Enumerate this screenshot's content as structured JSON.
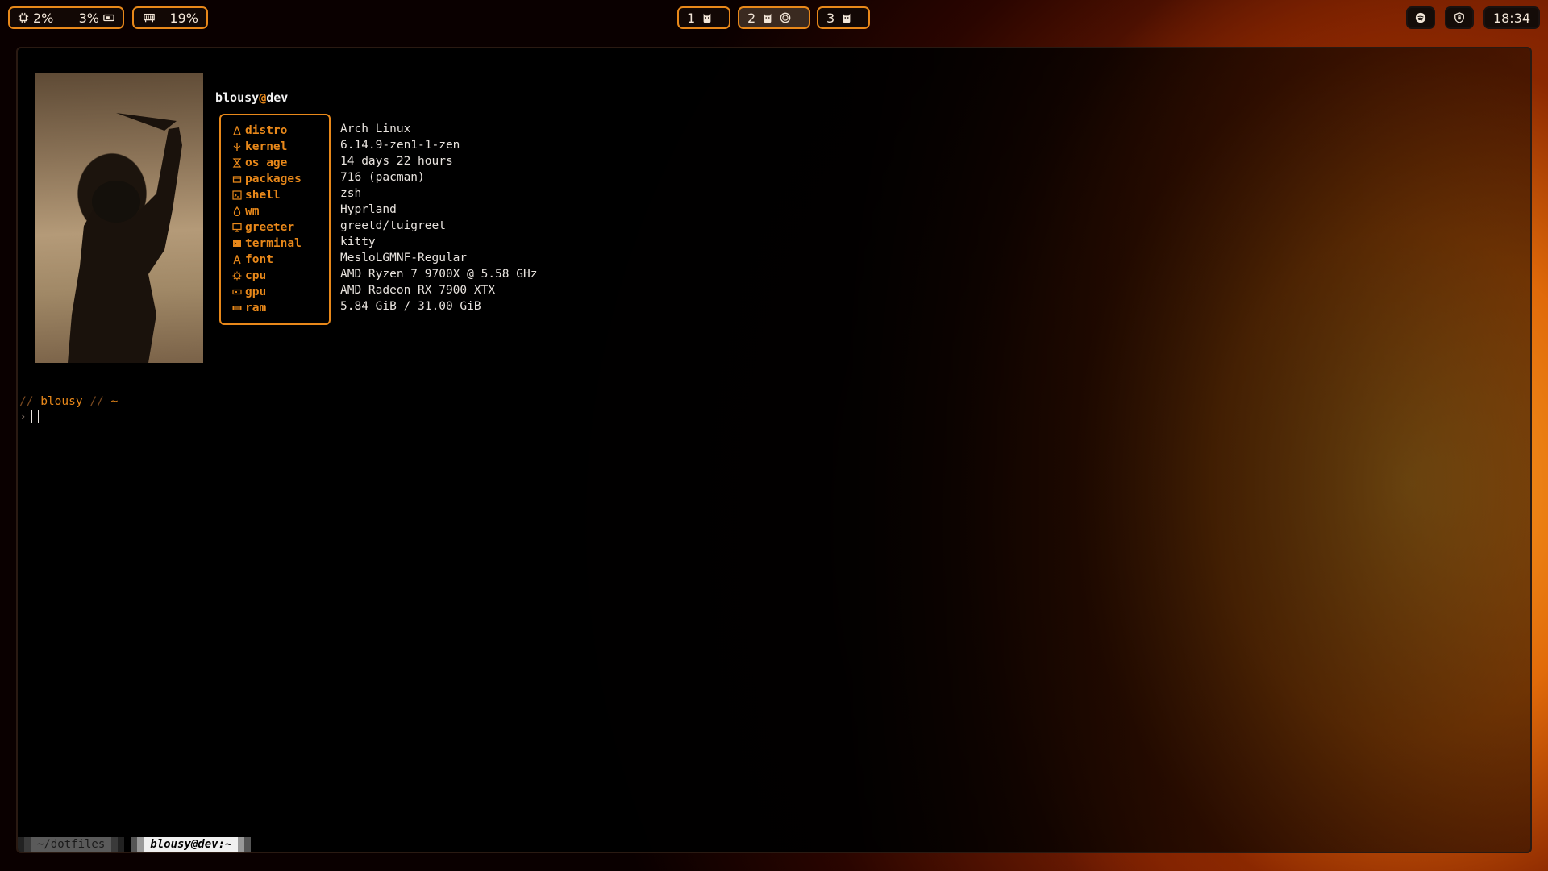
{
  "topbar": {
    "cpu_usage": "2%",
    "gpu_usage": "3%",
    "memory_usage": "19%",
    "workspaces": [
      {
        "number": "1",
        "icons": [
          "kitty-icon"
        ]
      },
      {
        "number": "2",
        "icons": [
          "kitty-icon",
          "spotify-icon"
        ],
        "active": true
      },
      {
        "number": "3",
        "icons": [
          "kitty-icon"
        ]
      }
    ],
    "clock": "18:34"
  },
  "fetch": {
    "user": "blousy",
    "at": "@",
    "host": "dev",
    "rows": [
      {
        "label": "distro",
        "icon": "linux-icon",
        "value": "Arch Linux"
      },
      {
        "label": "kernel",
        "icon": "kernel-icon",
        "value": "6.14.9-zen1-1-zen"
      },
      {
        "label": "os age",
        "icon": "hourglass-icon",
        "value": "14 days 22 hours"
      },
      {
        "label": "packages",
        "icon": "package-icon",
        "value": "716 (pacman)"
      },
      {
        "label": "shell",
        "icon": "terminal-prompt-icon",
        "value": "zsh"
      },
      {
        "label": "wm",
        "icon": "droplet-icon",
        "value": "Hyprland"
      },
      {
        "label": "greeter",
        "icon": "monitor-icon",
        "value": "greetd/tuigreet"
      },
      {
        "label": "terminal",
        "icon": "terminal-icon",
        "value": "kitty"
      },
      {
        "label": "font",
        "icon": "font-icon",
        "value": "MesloLGMNF-Regular"
      },
      {
        "label": "cpu",
        "icon": "cpu-icon",
        "value": "AMD Ryzen 7 9700X @ 5.58 GHz"
      },
      {
        "label": "gpu",
        "icon": "gpu-icon",
        "value": "AMD Radeon RX 7900 XTX"
      },
      {
        "label": "ram",
        "icon": "ram-icon",
        "value": "5.84 GiB / 31.00 GiB"
      }
    ]
  },
  "prompt": {
    "sep1": "//",
    "user": "blousy",
    "sep2": "//",
    "dir": "~",
    "symbol": "›"
  },
  "tabs": [
    {
      "label": "~/dotfiles",
      "active": false
    },
    {
      "label": "blousy@dev:~",
      "active": true
    }
  ],
  "colors": {
    "accent": "#e8881a",
    "text": "#e8e3de"
  }
}
